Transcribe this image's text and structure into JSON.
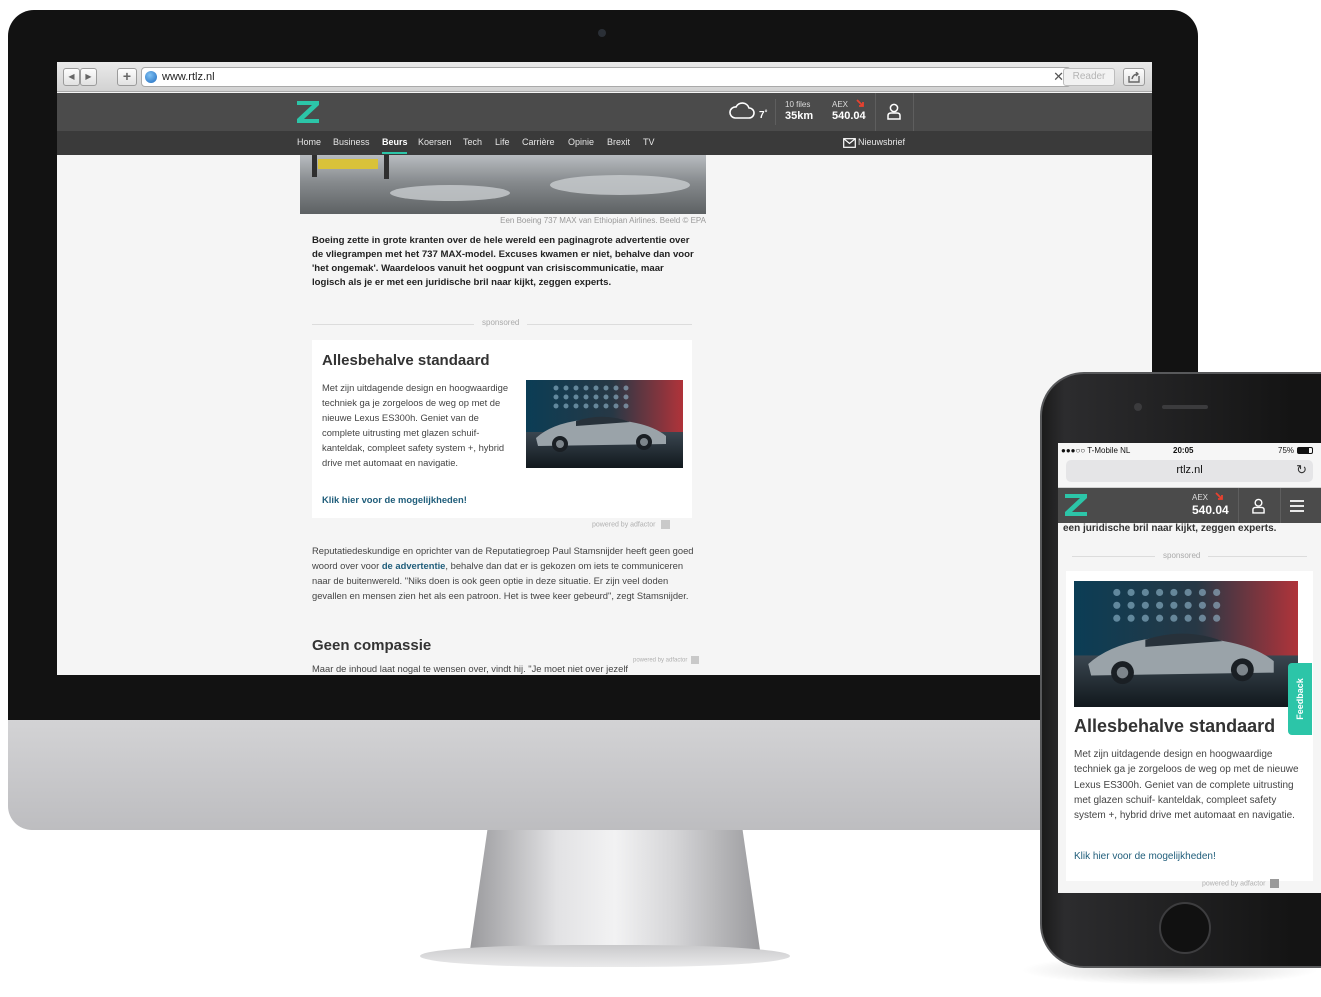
{
  "browser": {
    "url": "www.rtlz.nl",
    "reader_label": "Reader",
    "back_glyph": "◀",
    "forward_glyph": "▶",
    "add_glyph": "+",
    "close_glyph": "✕"
  },
  "site": {
    "weather_temp": "7",
    "weather_unit": "°",
    "files_label": "10 files",
    "files_km": "35km",
    "aex_label": "AEX",
    "aex_value": "540.04",
    "newsletter_label": "Nieuwsbrief",
    "nav": [
      "Home",
      "Business",
      "Beurs",
      "Koersen",
      "Tech",
      "Life",
      "Carrière",
      "Opinie",
      "Brexit",
      "TV"
    ],
    "active_nav": "Beurs",
    "accent_color": "#2cc5a8",
    "aex_down_color": "#e8412f",
    "link_color": "#1f5d7a"
  },
  "article": {
    "hero_caption": "Een Boeing 737 MAX van Ethiopian Airlines. Beeld © EPA",
    "lead": "Boeing zette in grote kranten over de hele wereld een paginagrote advertentie over de vliegrampen met het 737 MAX-model. Excuses kwamen er niet, behalve dan voor 'het ongemak'. Waardeloos vanuit het oogpunt van crisiscommunicatie, maar logisch als je er met een juridische bril naar kijkt, zeggen experts.",
    "sponsored_label": "sponsored",
    "ad_title": "Allesbehalve standaard",
    "ad_body": "Met zijn uitdagende design en hoogwaardige techniek ga je zorgeloos de weg op met de nieuwe Lexus ES300h. Geniet van de complete uitrusting met glazen schuif- kanteldak, compleet safety system +, hybrid drive met automaat en navigatie.",
    "ad_link": "Klik hier voor de mogelijkheden!",
    "powered_by": "powered by adfactor",
    "body_before_link": "Reputatiedeskundige en oprichter van de Reputatiegroep Paul Stamsnijder heeft geen goed woord over voor ",
    "body_link": "de advertentie",
    "body_after_link": ", behalve dan dat er is gekozen om iets te communiceren naar de buitenwereld. \"Niks doen is ook geen optie in deze situatie. Er zijn veel doden gevallen en mensen zien het als een patroon. Het is twee keer gebeurd\", zegt Stamsnijder.",
    "section_heading": "Geen compassie",
    "body_2": "Maar de inhoud laat nogal te wensen over, vindt hij. \"Je moet niet over jezelf"
  },
  "phone": {
    "carrier": "●●●○○ T-Mobile NL",
    "time": "20:05",
    "battery": "75%",
    "url": "rtlz.nl",
    "reload_glyph": "↻",
    "lead_tail": "een juridische bril naar kijkt, zeggen experts.",
    "feedback_label": "Feedback"
  }
}
